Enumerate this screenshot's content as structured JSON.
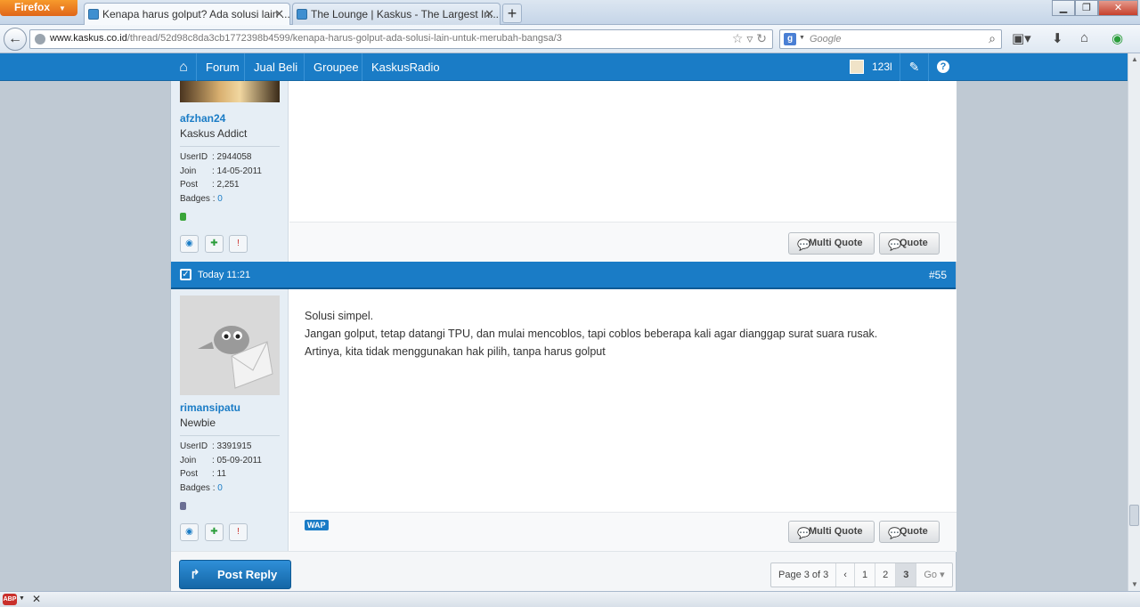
{
  "browser": {
    "app_button": "Firefox",
    "tabs": [
      {
        "title": "Kenapa harus golput? Ada solusi lain ..."
      },
      {
        "title": "The Lounge | Kaskus - The Largest In..."
      }
    ],
    "new_tab": "+",
    "url_domain": "www.kaskus.co.id",
    "url_path": "/thread/52d98c8da3cb1772398b4599/kenapa-harus-golput-ada-solusi-lain-untuk-merubah-bangsa/3",
    "search_placeholder": "Google",
    "search_engine_letter": "g"
  },
  "site_nav": {
    "items": [
      "Forum",
      "Jual Beli",
      "Groupee",
      "KaskusRadio"
    ],
    "username": "123l"
  },
  "posts": [
    {
      "username": "afzhan24",
      "rank": "Kaskus Addict",
      "stats": {
        "userid_label": "UserID",
        "userid": ": 2944058",
        "join_label": "Join",
        "join": ": 14-05-2011",
        "post_label": "Post",
        "post": ": 2,251",
        "badges_label": "Badges",
        "badges_sep": ":",
        "badges": "0"
      },
      "status_color": "#3aa53a",
      "multi_quote": "Multi Quote",
      "quote": "Quote"
    },
    {
      "header_time": "Today 11:21",
      "header_number": "#55",
      "username": "rimansipatu",
      "rank": "Newbie",
      "stats": {
        "userid_label": "UserID",
        "userid": ": 3391915",
        "join_label": "Join",
        "join": ": 05-09-2011",
        "post_label": "Post",
        "post": ": 11",
        "badges_label": "Badges",
        "badges_sep": ":",
        "badges": "0"
      },
      "status_color": "#6b6f94",
      "body": [
        "Solusi simpel.",
        "Jangan golput, tetap datangi TPU, dan mulai mencoblos, tapi coblos beberapa kali agar dianggap surat suara rusak.",
        "Artinya, kita tidak menggunakan hak pilih, tanpa harus golput"
      ],
      "wap_label": "WAP",
      "multi_quote": "Multi Quote",
      "quote": "Quote"
    }
  ],
  "reply_bar": {
    "post_reply": "Post Reply",
    "pager": {
      "summary": "Page 3 of 3",
      "prev": "‹",
      "pages": [
        "1",
        "2",
        "3"
      ],
      "current": "3",
      "go": "Go"
    }
  },
  "addon_bar": {
    "abp_label": "ABP"
  }
}
